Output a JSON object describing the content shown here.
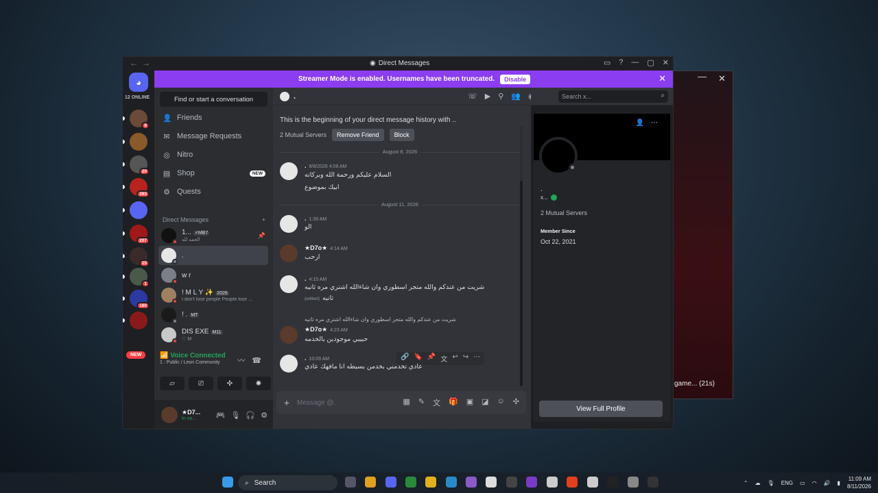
{
  "window": {
    "title": "Direct Messages",
    "title_icon": "discord-icon"
  },
  "background_window": {
    "status": "game... (21s)"
  },
  "rail": {
    "online_label": "12 ONLINE",
    "servers": [
      {
        "badge": "6",
        "color": "#6b4a3a"
      },
      {
        "badge": "",
        "color": "#8a5a2a"
      },
      {
        "badge": "20",
        "color": "#555"
      },
      {
        "badge": "393",
        "color": "#b8231e"
      },
      {
        "badge": "",
        "color": "#5865f2"
      },
      {
        "badge": "207",
        "color": "#a01818"
      },
      {
        "badge": "15",
        "color": "#3a2a2a"
      },
      {
        "badge": "1",
        "color": "#4a5a4a"
      },
      {
        "badge": "160",
        "color": "#2a3aa0"
      },
      {
        "badge": "",
        "color": "#8a1a1a"
      }
    ],
    "new_label": "NEW"
  },
  "banner": {
    "text": "Streamer Mode is enabled. Usernames have been truncated.",
    "disable_label": "Disable"
  },
  "sidebar": {
    "find_label": "Find or start a conversation",
    "nav": [
      {
        "label": "Friends",
        "icon": "friends-icon"
      },
      {
        "label": "Message Requests",
        "icon": "mail-icon"
      },
      {
        "label": "Nitro",
        "icon": "nitro-icon"
      },
      {
        "label": "Shop",
        "icon": "shop-icon",
        "badge": "NEW"
      },
      {
        "label": "Quests",
        "icon": "quests-icon"
      }
    ],
    "dm_header": "Direct Messages",
    "dms": [
      {
        "name": "1...",
        "tag": "⚡MB7",
        "sub": "الحمد لله"
      },
      {
        "name": ".",
        "tag": "",
        "sub": ""
      },
      {
        "name": "w r",
        "tag": "",
        "sub": ""
      },
      {
        "name": "! M L Y ✨",
        "tag": "2026",
        "sub": "I don't lose people People lose ..."
      },
      {
        "name": "! .",
        "tag": "MT",
        "sub": ""
      },
      {
        "name": "DIS EXE",
        "tag": "M11",
        "sub": "♡ M"
      }
    ]
  },
  "voice": {
    "status": "Voice Connected",
    "channel": "1 : Public / Leon Community"
  },
  "user": {
    "name": "★D7...",
    "status": "In vo..."
  },
  "chat": {
    "recipient": ".",
    "begin_text": "This is the beginning of your direct message history with ..",
    "mutual_servers": "2 Mutual Servers",
    "remove_friend": "Remove Friend",
    "block": "Block",
    "dates": [
      "August 8, 2026",
      "August 11, 2026"
    ],
    "messages": [
      {
        "author": ".",
        "time": "8/8/2026 4:08 AM",
        "lines": [
          "السلام عليكم ورحمة الله وبركاته",
          "ابيك بموضوع"
        ]
      },
      {
        "author": ".",
        "time": "1:39 AM",
        "lines": [
          "الو"
        ]
      },
      {
        "author": "★D7o★",
        "time": "4:14 AM",
        "lines": [
          "ارحب"
        ]
      },
      {
        "author": ".",
        "time": "4:15 AM",
        "lines": [
          "شريت من عندكم والله متجر اسطوري وان شاءالله اشتري مره ثانيه",
          "ثانيه"
        ],
        "edited": "(edited)"
      },
      {
        "author": "★D7o★",
        "time": "4:23 AM",
        "reply": "شريت من عندكم والله متجر اسطوري وان شاءالله اشتري مره ثانيه",
        "lines": [
          "حبيبي موجودين بالخدمه"
        ]
      },
      {
        "author": ".",
        "time": "10:09 AM",
        "lines": [
          "عادي تخدمني بخدمن بسيطه انا مافهك عادي"
        ]
      }
    ],
    "placeholder": "Message @."
  },
  "profile": {
    "search_placeholder": "Search x...",
    "name": ".",
    "username": "x...",
    "mutual": "2 Mutual Servers",
    "member_since_label": "Member Since",
    "member_since": "Oct 22, 2021",
    "view_full": "View Full Profile"
  },
  "taskbar": {
    "search": "Search",
    "lang": "ENG",
    "time": "11:09 AM",
    "date": "8/11/2026"
  }
}
